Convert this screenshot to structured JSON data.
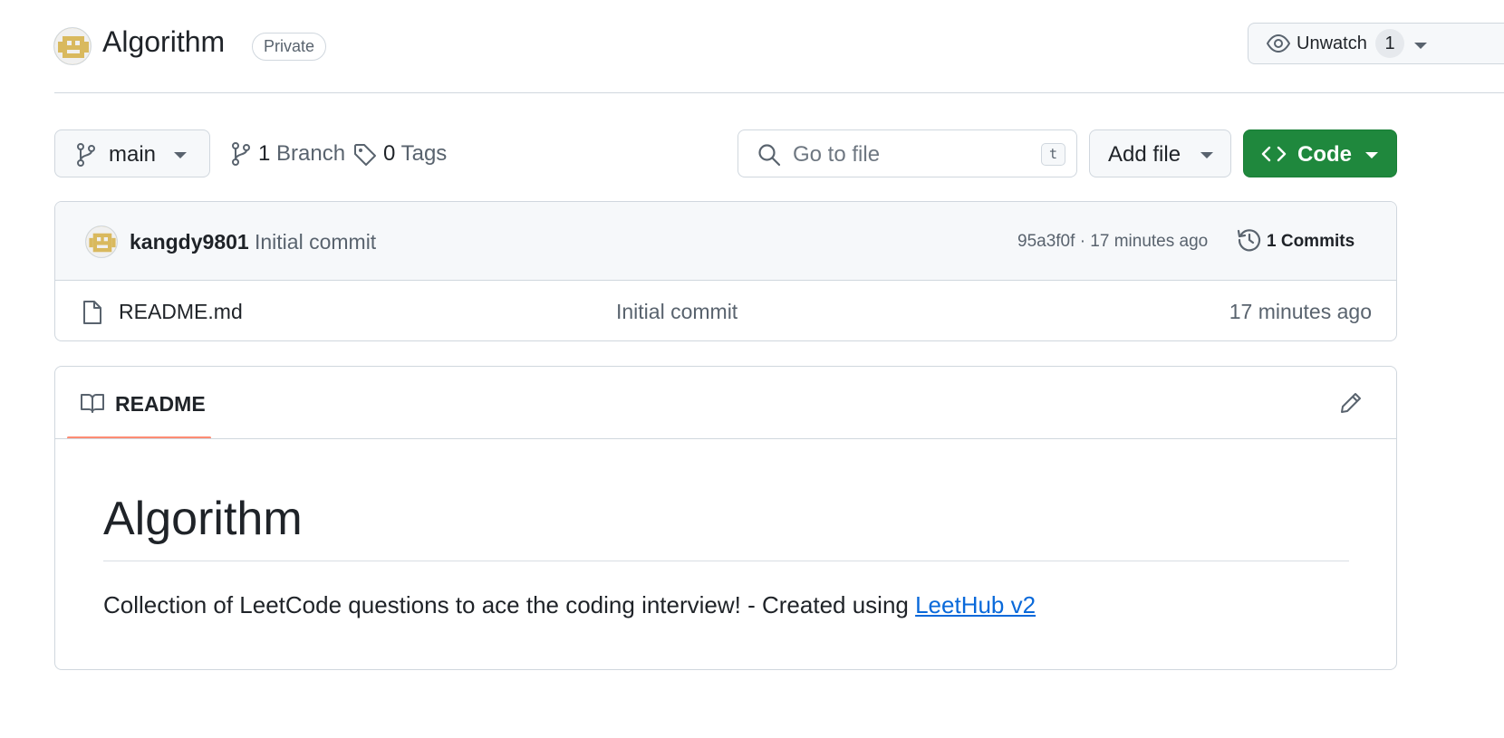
{
  "repo": {
    "name": "Algorithm",
    "visibility": "Private"
  },
  "watch": {
    "label": "Unwatch",
    "count": "1"
  },
  "toolbar": {
    "branch": "main",
    "branches_count": "1",
    "branches_label": "Branch",
    "tags_count": "0",
    "tags_label": "Tags",
    "search_placeholder": "Go to file",
    "search_shortcut": "t",
    "add_file_label": "Add file",
    "code_label": "Code"
  },
  "latest_commit": {
    "author": "kangdy9801",
    "message": "Initial commit",
    "hash": "95a3f0f",
    "separator": "·",
    "time": "17 minutes ago",
    "commits_label": "1 Commits"
  },
  "files": [
    {
      "name": "README.md",
      "commit_message": "Initial commit",
      "time": "17 minutes ago"
    }
  ],
  "readme": {
    "tab_label": "README",
    "heading": "Algorithm",
    "paragraph_text": "Collection of LeetCode questions to ace the coding interview! - Created using ",
    "link_text": "LeetHub v2"
  },
  "colors": {
    "code_button": "#1f883d",
    "link": "#0969da",
    "tab_underline": "#fd8c73",
    "avatar": "#d9b95e"
  },
  "icons": [
    "avatar-identicon",
    "eye-icon",
    "branch-icon",
    "tag-icon",
    "search-icon",
    "code-icon",
    "history-icon",
    "file-icon",
    "book-icon",
    "pencil-icon",
    "caret-down-icon"
  ]
}
